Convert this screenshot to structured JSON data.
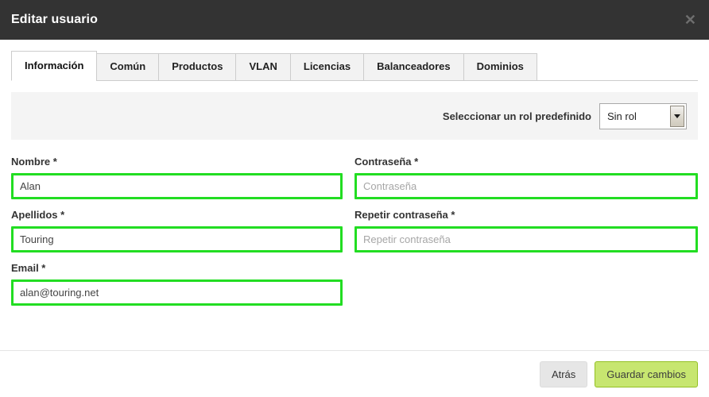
{
  "header": {
    "title": "Editar usuario",
    "close_icon": "close-icon",
    "close_glyph": "✕"
  },
  "tabs": [
    {
      "label": "Información",
      "active": true
    },
    {
      "label": "Común",
      "active": false
    },
    {
      "label": "Productos",
      "active": false
    },
    {
      "label": "VLAN",
      "active": false
    },
    {
      "label": "Licencias",
      "active": false
    },
    {
      "label": "Balanceadores",
      "active": false
    },
    {
      "label": "Dominios",
      "active": false
    }
  ],
  "role_panel": {
    "label": "Seleccionar un rol predefinido",
    "select_value": "Sin rol",
    "caret_icon": "chevron-down-icon"
  },
  "form": {
    "nombre": {
      "label": "Nombre *",
      "value": "Alan",
      "placeholder": ""
    },
    "contrasena": {
      "label": "Contraseña *",
      "value": "",
      "placeholder": "Contraseña"
    },
    "apellidos": {
      "label": "Apellidos *",
      "value": "Touring",
      "placeholder": ""
    },
    "repetir_contrasena": {
      "label": "Repetir contraseña *",
      "value": "",
      "placeholder": "Repetir contraseña"
    },
    "email": {
      "label": "Email *",
      "value": "alan@touring.net",
      "placeholder": ""
    }
  },
  "footer": {
    "back_label": "Atrás",
    "save_label": "Guardar cambios"
  },
  "colors": {
    "header_bg": "#333333",
    "field_border_valid": "#22dd22",
    "save_button_bg": "#c7e670",
    "save_button_border": "#93c023",
    "panel_bg": "#f4f4f4"
  }
}
